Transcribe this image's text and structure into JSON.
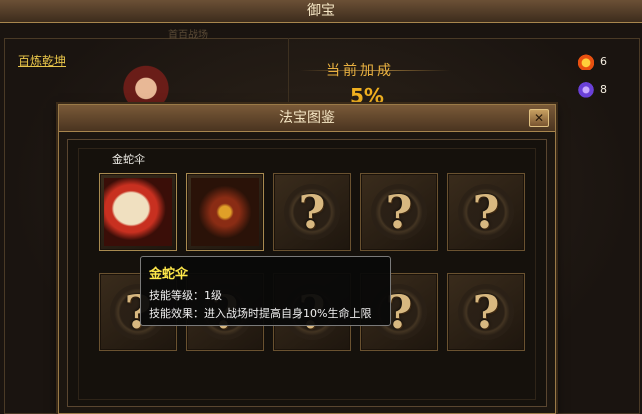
{
  "window": {
    "title": "御宝"
  },
  "background": {
    "faint_tab": "首百战场",
    "link": "百炼乾坤",
    "bonus_label": "当前加成",
    "bonus_value": "5%",
    "resources": [
      {
        "icon": "fire-icon",
        "value": "6"
      },
      {
        "icon": "purple-gem-icon",
        "value": "8"
      }
    ]
  },
  "dialog": {
    "title": "法宝图鉴",
    "close_label": "✕",
    "slots": [
      {
        "name": "金蛇伞",
        "state": "owned",
        "art": "umbrella"
      },
      {
        "state": "owned",
        "art": "totem"
      },
      {
        "state": "unknown",
        "label": "?"
      },
      {
        "state": "unknown",
        "label": "?"
      },
      {
        "state": "unknown",
        "label": "?"
      },
      {
        "state": "unknown",
        "label": "?"
      },
      {
        "state": "unknown",
        "label": "?"
      },
      {
        "state": "unknown",
        "label": "?"
      },
      {
        "state": "unknown",
        "label": "?"
      },
      {
        "state": "unknown",
        "label": "?"
      }
    ],
    "slot_caption": "金蛇伞"
  },
  "tooltip": {
    "title": "金蛇伞",
    "level": "技能等级：1级",
    "effect": "技能效果：进入战场时提高自身10%生命上限"
  }
}
